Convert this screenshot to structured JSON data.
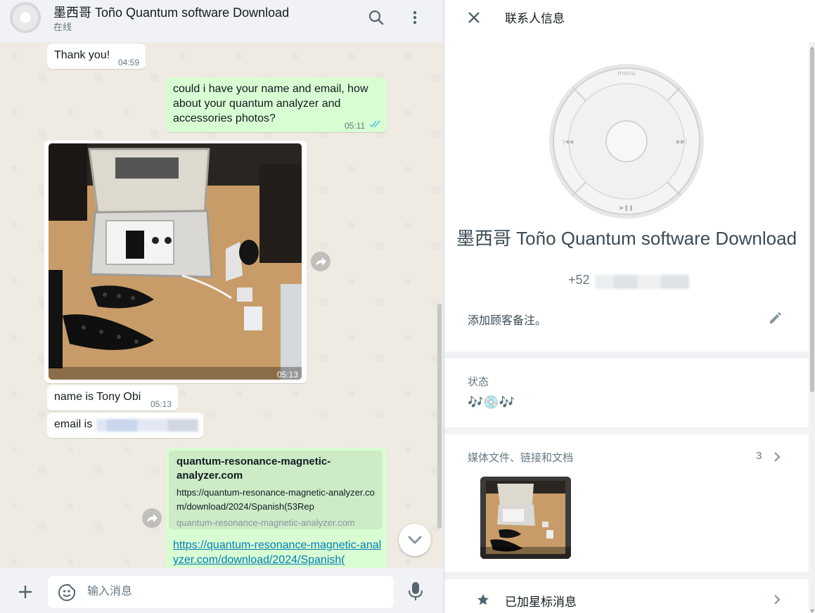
{
  "chat": {
    "title": "墨西哥 Toño Quantum software Download",
    "status": "在线"
  },
  "messages": {
    "m1": {
      "text": "Thank you!",
      "time": "04:59"
    },
    "m2": {
      "text": "could i have your name and email, how about your quantum analyzer and accessories photos?",
      "time": "05:11"
    },
    "m3": {
      "time": "05:13"
    },
    "m4": {
      "text": "name is Tony Obi",
      "time": "05:13"
    },
    "m5": {
      "text": "email is"
    },
    "m6": {
      "site": "quantum-resonance-magnetic-analyzer.com",
      "url": "https://quantum-resonance-magnetic-analyzer.com/download/2024/Spanish(53Rep",
      "domain": "quantum-resonance-magnetic-analyzer.com",
      "link": "https://quantum-resonance-magnetic-analyzer.com/download/2024/Spanish("
    }
  },
  "composer": {
    "placeholder": "输入消息"
  },
  "info": {
    "title": "联系人信息",
    "name": "墨西哥 Toño Quantum software Download",
    "phone_prefix": "+52",
    "note_label": "添加顾客备注。",
    "status_label": "状态",
    "status_value": "🎶💿🎶",
    "media_label": "媒体文件、链接和文档",
    "media_count": "3",
    "starred_label": "已加星标消息"
  },
  "colors": {
    "outgoing_bubble": "#d9fdd3",
    "incoming_bubble": "#ffffff",
    "link": "#027eb5",
    "read_ticks": "#53bdeb",
    "chat_background": "#efeae2"
  }
}
